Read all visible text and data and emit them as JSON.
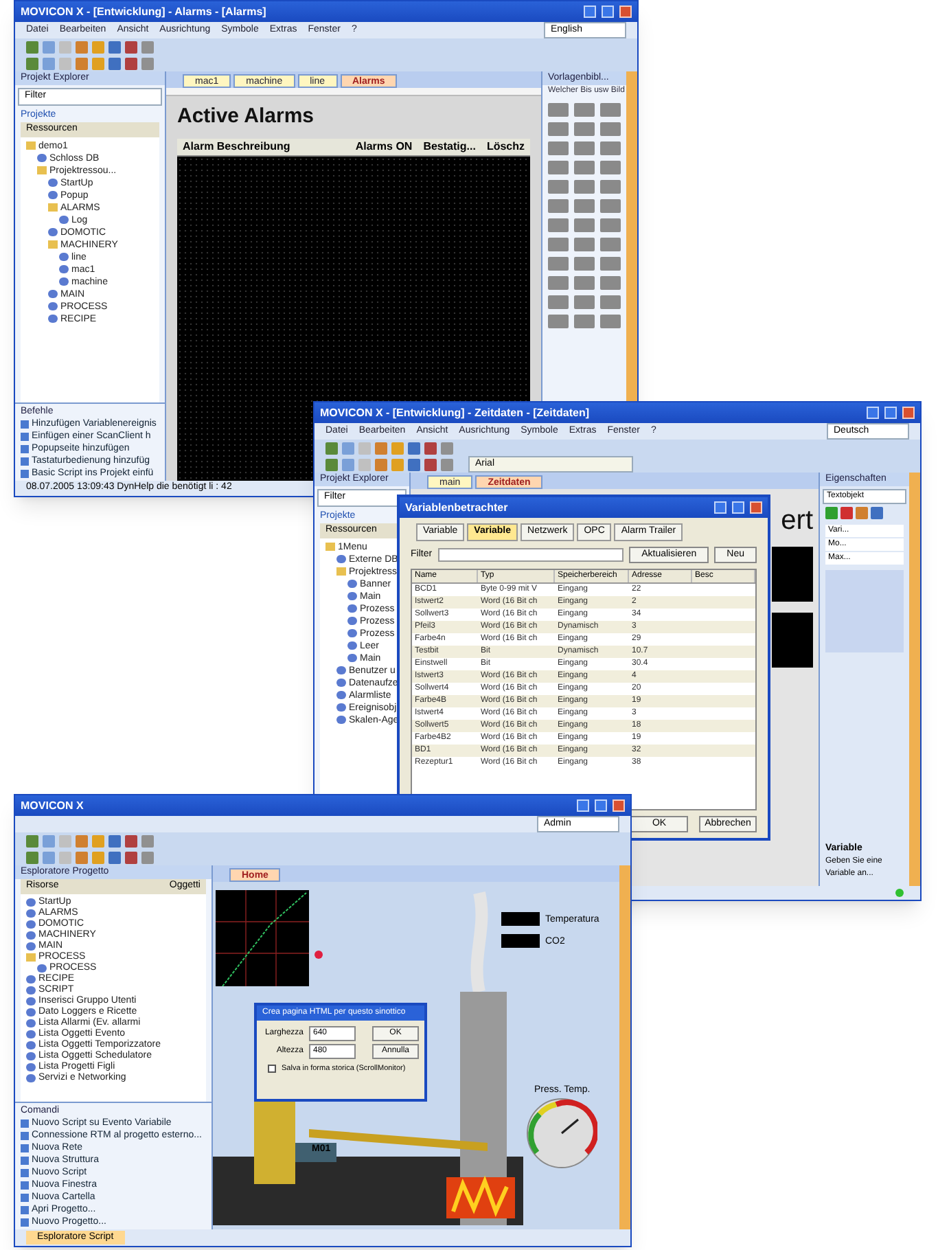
{
  "alarms_window": {
    "title": "MOVICON X - [Entwicklung] - Alarms - [Alarms]",
    "menu": [
      "Datei",
      "Bearbeiten",
      "Ansicht",
      "Ausrichtung",
      "Symbole",
      "Extras",
      "Fenster",
      "?"
    ],
    "language": "English",
    "explorer": {
      "title": "Projekt Explorer",
      "filter": "Filter",
      "section": "Projekte",
      "resources": "Ressourcen",
      "tree": [
        {
          "label": "demo1",
          "children": [
            {
              "label": "Schloss DB"
            },
            {
              "label": "Projektressou...",
              "children": [
                {
                  "label": "StartUp"
                },
                {
                  "label": "Popup"
                },
                {
                  "label": "ALARMS",
                  "children": [
                    {
                      "label": "Log"
                    }
                  ]
                },
                {
                  "label": "DOMOTIC"
                },
                {
                  "label": "MACHINERY",
                  "children": [
                    {
                      "label": "line"
                    },
                    {
                      "label": "mac1"
                    },
                    {
                      "label": "machine"
                    }
                  ]
                },
                {
                  "label": "MAIN"
                },
                {
                  "label": "PROCESS"
                },
                {
                  "label": "RECIPE"
                }
              ]
            }
          ]
        }
      ]
    },
    "tabs": [
      {
        "label": "mac1",
        "selected": false
      },
      {
        "label": "machine",
        "selected": false
      },
      {
        "label": "line",
        "selected": false
      },
      {
        "label": "Alarms",
        "selected": true
      }
    ],
    "page_title": "Active Alarms",
    "columns": [
      "Alarm Beschreibung",
      "Alarms ON",
      "Bestatig...",
      "Löschz"
    ],
    "toolbox_title": "Vorlagenbibl...",
    "toolbox_hint": "Welcher Bis usw Bild",
    "commands": {
      "title": "Befehle",
      "items": [
        "Hinzufügen Variablenereignis",
        "Einfügen einer ScanClient h",
        "Popupseite hinzufügen",
        "Tastaturbedienung hinzufüg",
        "Basic Script ins Projekt einfü"
      ]
    },
    "status": "08.07.2005 13:09:43 DynHelp die benötigt li : 42"
  },
  "variables_window": {
    "title": "MOVICON X - [Entwicklung] - Zeitdaten - [Zeitdaten]",
    "menu": [
      "Datei",
      "Bearbeiten",
      "Ansicht",
      "Ausrichtung",
      "Symbole",
      "Extras",
      "Fenster",
      "?"
    ],
    "language": "Deutsch",
    "font": "Arial",
    "explorer": {
      "title": "Projekt Explorer",
      "filter": "Filter",
      "section": "Projekte",
      "resources": "Ressourcen",
      "tree": [
        {
          "label": "1Menu",
          "children": [
            {
              "label": "Externe DB"
            },
            {
              "label": "Projektress",
              "children": [
                {
                  "label": "Banner"
                },
                {
                  "label": "Main"
                },
                {
                  "label": "Prozess"
                },
                {
                  "label": "Prozess"
                },
                {
                  "label": "Prozess"
                },
                {
                  "label": "Leer"
                },
                {
                  "label": "Main"
                }
              ]
            },
            {
              "label": "Benutzer u"
            },
            {
              "label": "Datenaufze"
            },
            {
              "label": "Alarmliste"
            },
            {
              "label": "Ereignisobj"
            },
            {
              "label": "Skalen-Age"
            }
          ]
        }
      ]
    },
    "tabs": [
      {
        "label": "main",
        "selected": false
      },
      {
        "label": "Zeitdaten",
        "selected": true
      }
    ],
    "page_text": "ert",
    "dialog": {
      "title": "Variablenbetrachter",
      "tabs": [
        {
          "label": "Variable",
          "selected": false
        },
        {
          "label": "Variable",
          "selected": true
        },
        {
          "label": "Netzwerk",
          "selected": false
        },
        {
          "label": "OPC",
          "selected": false
        },
        {
          "label": "Alarm Trailer",
          "selected": false
        }
      ],
      "filter_label": "Filter",
      "buttons_top": [
        "Aktualisieren",
        "Neu"
      ],
      "columns": [
        "Name",
        "Typ",
        "Speicherbereich",
        "Adresse",
        "Besc"
      ],
      "rows": [
        {
          "name": "BCD1",
          "type": "Byte 0-99 mit V",
          "area": "Eingang",
          "address": "22"
        },
        {
          "name": "Istwert2",
          "type": "Word (16 Bit ch",
          "area": "Eingang",
          "address": "2"
        },
        {
          "name": "Sollwert3",
          "type": "Word (16 Bit ch",
          "area": "Eingang",
          "address": "34"
        },
        {
          "name": "Pfeil3",
          "type": "Word (16 Bit ch",
          "area": "Dynamisch",
          "address": "3"
        },
        {
          "name": "Farbe4n",
          "type": "Word (16 Bit ch",
          "area": "Eingang",
          "address": "29"
        },
        {
          "name": "Testbit",
          "type": "Bit",
          "area": "Dynamisch",
          "address": "10.7"
        },
        {
          "name": "Einstwell",
          "type": "Bit",
          "area": "Eingang",
          "address": "30.4"
        },
        {
          "name": "Istwert3",
          "type": "Word (16 Bit ch",
          "area": "Eingang",
          "address": "4"
        },
        {
          "name": "Sollwert4",
          "type": "Word (16 Bit ch",
          "area": "Eingang",
          "address": "20"
        },
        {
          "name": "Farbe4B",
          "type": "Word (16 Bit ch",
          "area": "Eingang",
          "address": "19"
        },
        {
          "name": "Istwert4",
          "type": "Word (16 Bit ch",
          "area": "Eingang",
          "address": "3"
        },
        {
          "name": "Sollwert5",
          "type": "Word (16 Bit ch",
          "area": "Eingang",
          "address": "18"
        },
        {
          "name": "Farbe4B2",
          "type": "Word (16 Bit ch",
          "area": "Eingang",
          "address": "19"
        },
        {
          "name": "BD1",
          "type": "Word (16 Bit ch",
          "area": "Eingang",
          "address": "32"
        },
        {
          "name": "Rezeptur1",
          "type": "Word (16 Bit ch",
          "area": "Eingang",
          "address": "38"
        }
      ],
      "buttons_bottom": [
        "OK",
        "Abbrechen"
      ]
    },
    "properties": {
      "title": "Eigenschaften",
      "object": "Textobjekt",
      "rows": [
        "Vari...",
        "Mo...",
        "Max..."
      ],
      "help_title": "Variable",
      "help_text": "Geben Sie eine Variable an..."
    }
  },
  "plant_window": {
    "title": "MOVICON X",
    "user": "Admin",
    "explorer": {
      "title": "Esploratore Progetto",
      "resources": "Risorse",
      "objects": "Oggetti",
      "tree": [
        {
          "label": "StartUp"
        },
        {
          "label": "ALARMS"
        },
        {
          "label": "DOMOTIC"
        },
        {
          "label": "MACHINERY"
        },
        {
          "label": "MAIN"
        },
        {
          "label": "PROCESS",
          "children": [
            {
              "label": "PROCESS"
            }
          ]
        },
        {
          "label": "RECIPE"
        },
        {
          "label": "SCRIPT"
        },
        {
          "label": "Inserisci Gruppo Utenti"
        },
        {
          "label": "Dato Loggers e Ricette"
        },
        {
          "label": "Lista Allarmi (Ev. allarmi"
        },
        {
          "label": "Lista Oggetti Evento"
        },
        {
          "label": "Lista Oggetti Temporizzatore"
        },
        {
          "label": "Lista Oggetti Schedulatore"
        },
        {
          "label": "Lista Progetti Figli"
        },
        {
          "label": "Servizi e Networking"
        }
      ]
    },
    "commands": {
      "title": "Comandi",
      "items": [
        "Nuovo Script su Evento Variabile",
        "Connessione RTM al progetto esterno...",
        "Nuova Rete",
        "Nuova Struttura",
        "Nuovo Script",
        "Nuova Finestra",
        "Nuova Cartella",
        "Apri Progetto...",
        "Nuovo Progetto..."
      ]
    },
    "tabs": [
      {
        "label": "Home",
        "selected": true
      }
    ],
    "labels": {
      "temperature": "Temperatura",
      "co2": "CO2",
      "gauge": "Press. Temp.",
      "motor": "M01"
    },
    "dialog": {
      "title": "Crea pagina HTML per questo sinottico",
      "width_label": "Larghezza",
      "width_value": "640",
      "height_label": "Altezza",
      "height_value": "480",
      "buttons": [
        "OK",
        "Annulla"
      ],
      "checkbox": {
        "label": "Salva in forma storica (ScrollMonitor)",
        "checked": false
      }
    },
    "bottom_tab": "Esploratore Script"
  }
}
